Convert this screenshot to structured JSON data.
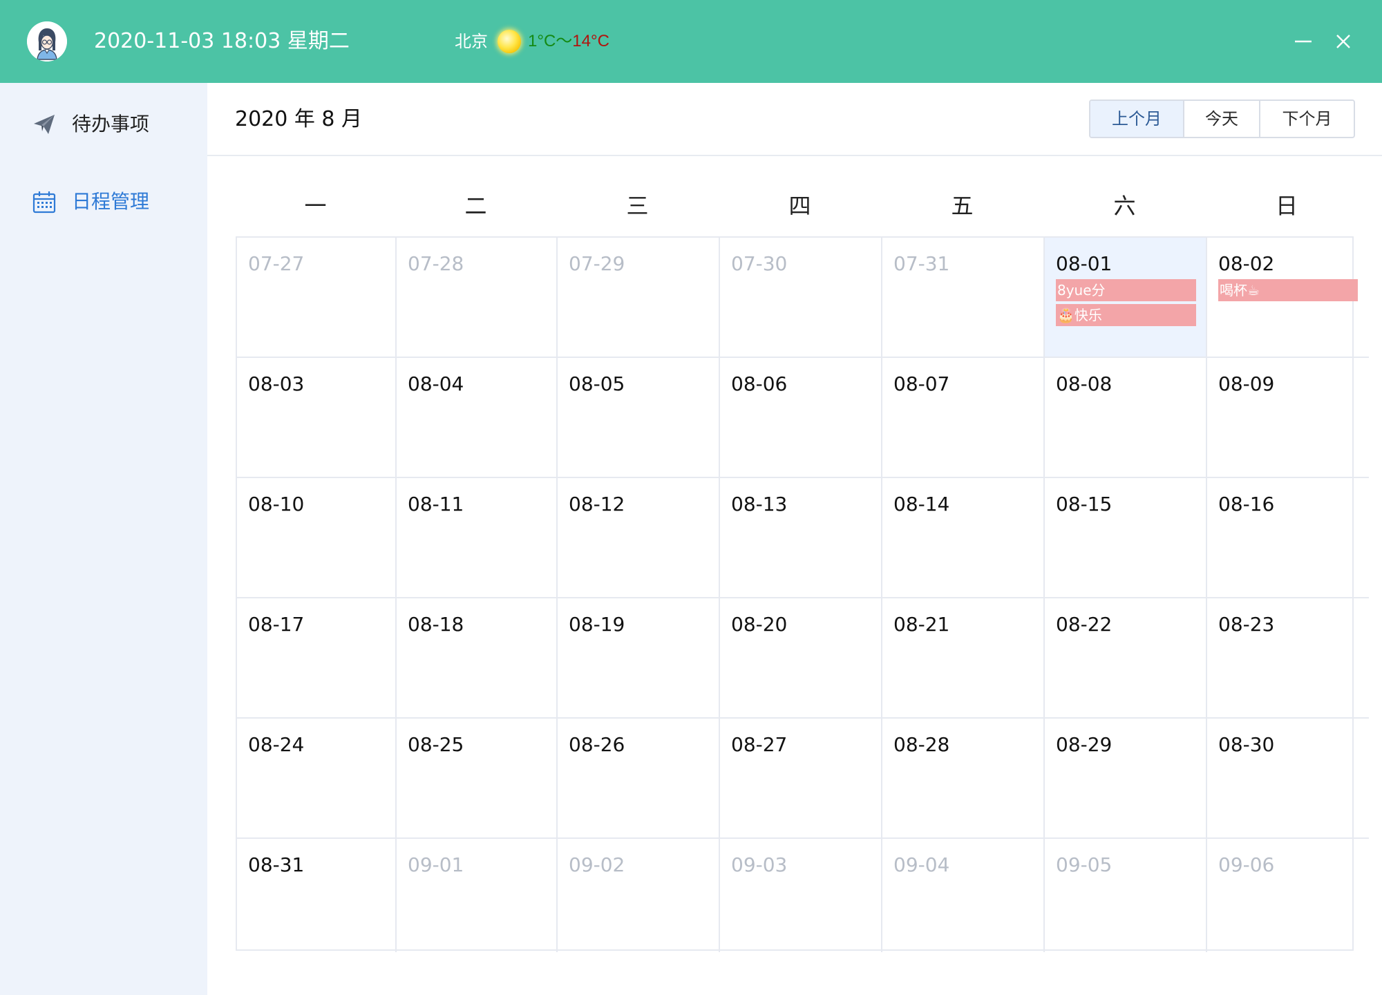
{
  "titlebar": {
    "datetime": "2020-11-03 18:03 星期二",
    "city": "北京",
    "weather_icon": "sun-icon",
    "temp_min": "1°C",
    "temp_sep": "～",
    "temp_max": "14°C",
    "color_bar": "#4cc3a5"
  },
  "sidebar": {
    "items": [
      {
        "label": "待办事项",
        "icon": "paper-plane-icon",
        "active": false
      },
      {
        "label": "日程管理",
        "icon": "calendar-icon",
        "active": true
      }
    ],
    "active_color": "#2e7ad6"
  },
  "header": {
    "month_title": "2020 年 8 月",
    "buttons": {
      "prev": "上个月",
      "today": "今天",
      "next": "下个月"
    }
  },
  "calendar": {
    "weekdays": [
      "一",
      "二",
      "三",
      "四",
      "五",
      "六",
      "日"
    ],
    "weeks": [
      [
        {
          "date": "07-27",
          "other": true
        },
        {
          "date": "07-28",
          "other": true
        },
        {
          "date": "07-29",
          "other": true
        },
        {
          "date": "07-30",
          "other": true
        },
        {
          "date": "07-31",
          "other": true
        },
        {
          "date": "08-01",
          "highlight": true,
          "events": [
            "8yue分",
            "🎂快乐"
          ]
        },
        {
          "date": "08-02",
          "events": [
            "喝杯☕"
          ]
        }
      ],
      [
        {
          "date": "08-03"
        },
        {
          "date": "08-04"
        },
        {
          "date": "08-05"
        },
        {
          "date": "08-06"
        },
        {
          "date": "08-07"
        },
        {
          "date": "08-08"
        },
        {
          "date": "08-09"
        }
      ],
      [
        {
          "date": "08-10"
        },
        {
          "date": "08-11"
        },
        {
          "date": "08-12"
        },
        {
          "date": "08-13"
        },
        {
          "date": "08-14"
        },
        {
          "date": "08-15"
        },
        {
          "date": "08-16"
        }
      ],
      [
        {
          "date": "08-17"
        },
        {
          "date": "08-18"
        },
        {
          "date": "08-19"
        },
        {
          "date": "08-20"
        },
        {
          "date": "08-21"
        },
        {
          "date": "08-22"
        },
        {
          "date": "08-23"
        }
      ],
      [
        {
          "date": "08-24"
        },
        {
          "date": "08-25"
        },
        {
          "date": "08-26"
        },
        {
          "date": "08-27"
        },
        {
          "date": "08-28"
        },
        {
          "date": "08-29"
        },
        {
          "date": "08-30"
        }
      ],
      [
        {
          "date": "08-31"
        },
        {
          "date": "09-01",
          "other": true
        },
        {
          "date": "09-02",
          "other": true
        },
        {
          "date": "09-03",
          "other": true
        },
        {
          "date": "09-04",
          "other": true
        },
        {
          "date": "09-05",
          "other": true
        },
        {
          "date": "09-06",
          "other": true
        }
      ]
    ],
    "event_color": "#f3a5a8",
    "highlight_color": "#ecf3fe"
  }
}
